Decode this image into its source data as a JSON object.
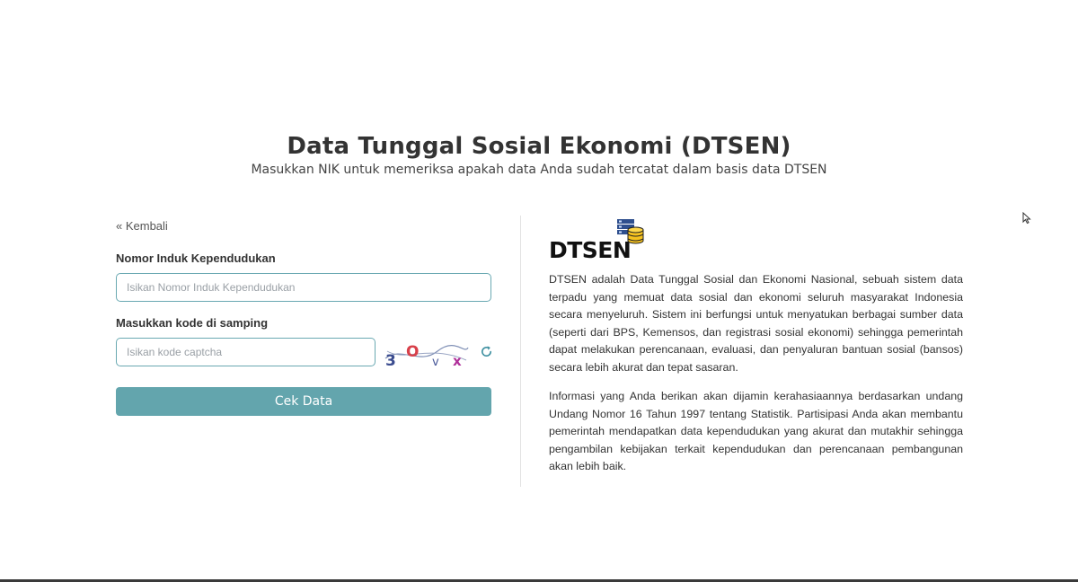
{
  "header": {
    "title": "Data Tunggal Sosial Ekonomi (DTSEN)",
    "subtitle": "Masukkan NIK untuk memeriksa apakah data Anda sudah tercatat dalam basis data DTSEN"
  },
  "form": {
    "back_label": "« Kembali",
    "nik_label": "Nomor Induk Kependudukan",
    "nik_placeholder": "Isikan Nomor Induk Kependudukan",
    "nik_value": "",
    "captcha_label": "Masukkan kode di samping",
    "captcha_placeholder": "Isikan kode captcha",
    "captcha_value": "",
    "captcha_chars": [
      "3",
      "O",
      "v",
      "x"
    ],
    "refresh_icon": "refresh-icon",
    "submit_label": "Cek Data"
  },
  "info": {
    "logo_text": "DTSEN",
    "logo_icon": "database-icon",
    "paragraph_1": "DTSEN adalah Data Tunggal Sosial dan Ekonomi Nasional, sebuah sistem data terpadu yang memuat data sosial dan ekonomi seluruh masyarakat Indonesia secara menyeluruh. Sistem ini berfungsi untuk menyatukan berbagai sumber data (seperti dari BPS, Kemensos, dan registrasi sosial ekonomi) sehingga pemerintah dapat melakukan perencanaan, evaluasi, dan penyaluran bantuan sosial (bansos) secara lebih akurat dan tepat sasaran.",
    "paragraph_2": "Informasi yang Anda berikan akan dijamin kerahasiaannya berdasarkan undang Undang Nomor 16 Tahun 1997 tentang Statistik. Partisipasi Anda akan membantu pemerintah mendapatkan data kependudukan yang akurat dan mutakhir sehingga pengambilan kebijakan terkait kependudukan dan perencanaan pembangunan akan lebih baik."
  },
  "colors": {
    "accent": "#63a5ad",
    "input_border": "#6aa9b2",
    "text": "#333333"
  }
}
